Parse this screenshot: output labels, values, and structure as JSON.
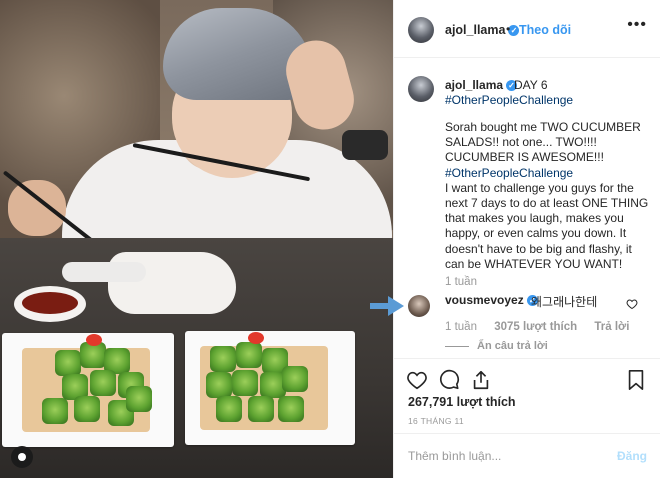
{
  "header": {
    "username": "ajol_llama",
    "separator": "•",
    "follow_label": "Theo dõi",
    "more_label": "•••"
  },
  "caption": {
    "username": "ajol_llama",
    "day": "DAY 6",
    "hashtag_top": "#OtherPeopleChallenge",
    "lines": [
      "Sorah bought me TWO CUCUMBER",
      "SALADS!! not one... TWO!!!!",
      "CUCUMBER IS AWESOME!!!",
      "#OtherPeopleChallenge",
      "I want to challenge you guys for the",
      "next 7 days to do at least ONE THING",
      "that makes you laugh, makes you",
      "happy, or even calms you down. It",
      "doesn't have to be big and flashy, it",
      "can be WHATEVER YOU WANT!"
    ],
    "time": "1 tuần"
  },
  "comment": {
    "username": "vousmevoyez",
    "text": "왜그래나한테",
    "time": "1 tuần",
    "likes": "3075 lượt thích",
    "reply": "Trả lời",
    "hide_replies": "Ẩn câu trả lời"
  },
  "likes_count": "267,791 lượt thích",
  "date": "16 THÁNG 11",
  "add_comment": {
    "placeholder": "Thêm bình luận...",
    "post_label": "Đăng"
  },
  "colors": {
    "link_blue": "#3897f0",
    "hashtag": "#003569",
    "muted": "#999999",
    "arrow": "#5b9bd5"
  }
}
